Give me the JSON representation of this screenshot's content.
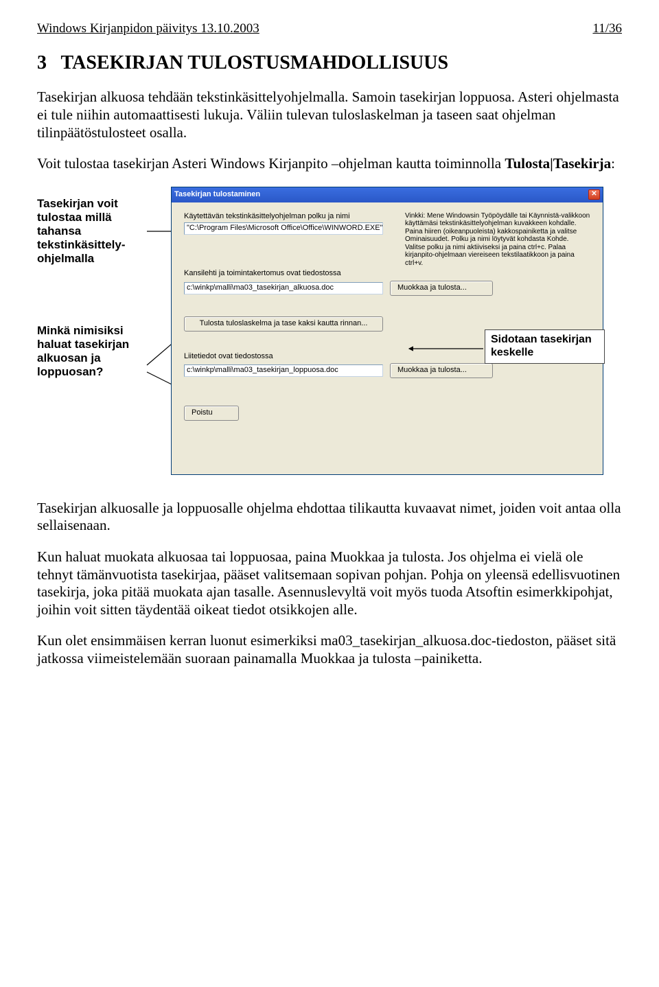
{
  "header": {
    "left": "Windows Kirjanpidon päivitys 13.10.2003",
    "right": "11/36"
  },
  "section": {
    "number": "3",
    "title": "TASEKIRJAN TULOSTUSMAHDOLLISUUS"
  },
  "paragraphs": {
    "p1": "Tasekirjan alkuosa tehdään tekstinkäsittelyohjelmalla. Samoin tasekirjan loppuosa. Asteri ohjelmasta ei tule niihin automaattisesti lukuja. Väliin tulevan tuloslaskelman ja taseen saat ohjelman tilinpäätöstulosteet osalla.",
    "p2_a": "Voit tulostaa tasekirjan Asteri Windows Kirjanpito –ohjelman kautta toiminnolla ",
    "p2_b": "Tulosta|Tasekirja",
    "p2_c": ":",
    "p3": "Tasekirjan alkuosalle ja loppuosalle ohjelma ehdottaa tilikautta kuvaavat nimet, joiden voit antaa olla sellaisenaan.",
    "p4": "Kun haluat muokata alkuosaa tai loppuosaa, paina Muokkaa ja tulosta. Jos ohjelma ei vielä ole tehnyt tämänvuotista tasekirjaa, pääset valitsemaan sopivan pohjan. Pohja on yleensä edellisvuotinen tasekirja, joka pitää muokata ajan tasalle. Asennuslevyltä voit myös tuoda Atsoftin esimerkkipohjat, joihin voit sitten täydentää oikeat tiedot otsikkojen alle.",
    "p5": "Kun olet ensimmäisen kerran luonut esimerkiksi ma03_tasekirjan_alkuosa.doc-tiedoston, pääset sitä jatkossa viimeistelemään suoraan painamalla Muokkaa ja tulosta –painiketta."
  },
  "callouts": {
    "c1": "Tasekirjan voit tulostaa millä tahansa tekstinkäsittely-ohjelmalla",
    "c2": "Minkä nimisiksi haluat tasekirjan alkuosan ja loppuosan?",
    "c3": "Sidotaan tasekirjan keskelle"
  },
  "dialog": {
    "title": "Tasekirjan tulostaminen",
    "lbl_path": "Käytettävän tekstinkäsittelyohjelman polku ja nimi",
    "input_path": "\"C:\\Program Files\\Microsoft Office\\Office\\WINWORD.EXE\"",
    "hint": "Vinkki: Mene Windowsin Työpöydälle tai Käynnistä-valikkoon käyttämäsi tekstinkäsittelyohjelman kuvakkeen kohdalle. Paina hiiren (oikeanpuoleista) kakkospainiketta ja valitse Ominaisuudet. Polku ja nimi löytyvät kohdasta Kohde. Valitse polku ja nimi aktiiviseksi ja paina ctrl+c. Palaa kirjanpito-ohjelmaan viereiseen tekstilaatikkoon ja paina ctrl+v.",
    "lbl_kansi": "Kansilehti ja toimintakertomus ovat tiedostossa",
    "input_kansi": "c:\\winkp\\malli\\ma03_tasekirjan_alkuosa.doc",
    "btn_muokkaa": "Muokkaa ja tulosta...",
    "btn_tulosta_tlt": "Tulosta tuloslaskelma ja tase kaksi kautta rinnan...",
    "lbl_liite": "Liitetiedot ovat tiedostossa",
    "input_liite": "c:\\winkp\\malli\\ma03_tasekirjan_loppuosa.doc",
    "btn_muokkaa2": "Muokkaa ja tulosta...",
    "btn_poistu": "Poistu"
  }
}
